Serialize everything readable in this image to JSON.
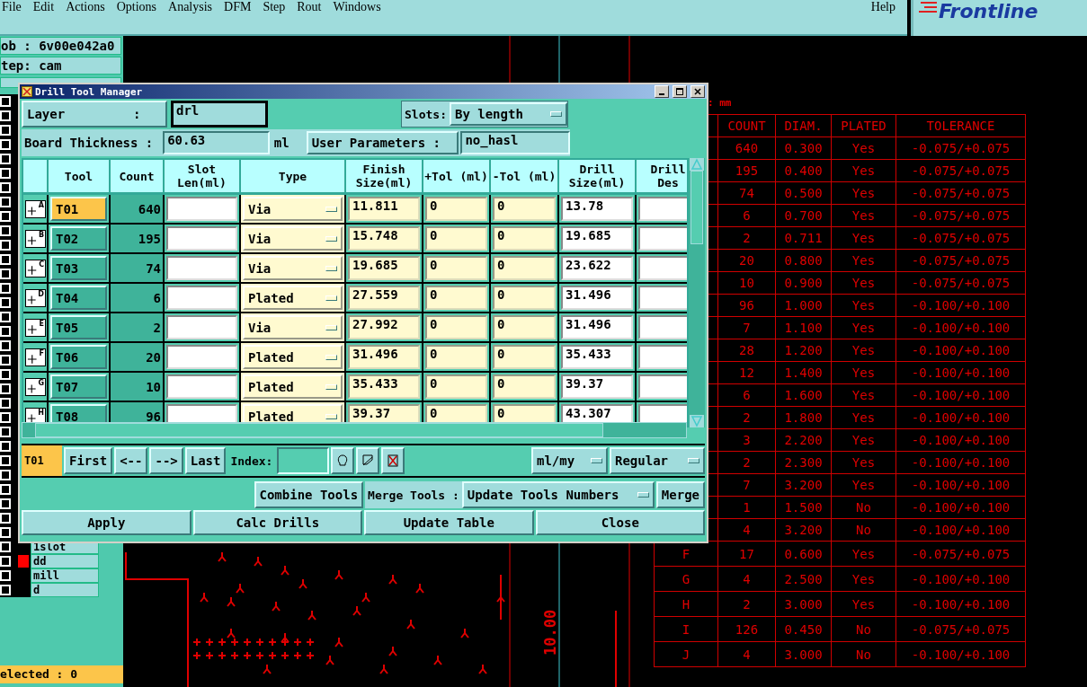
{
  "menu_bar": {
    "items": [
      "File",
      "Edit",
      "Actions",
      "Options",
      "Analysis",
      "DFM",
      "Step",
      "Rout",
      "Windows"
    ],
    "help": "Help",
    "logo": "Frontline"
  },
  "left_panel": {
    "job": "ob : 6v00e042a0",
    "step": "tep: cam",
    "layers": [
      {
        "name": "1slot",
        "selected": false
      },
      {
        "name": "dd",
        "selected": true
      },
      {
        "name": "mill",
        "selected": false
      },
      {
        "name": "d",
        "selected": false
      }
    ],
    "status": "elected : 0"
  },
  "canvas": {
    "units": ": mm",
    "columns": [
      "COUNT",
      "DIAM.",
      "PLATED",
      "TOLERANCE"
    ],
    "rows": [
      {
        "count": "640",
        "diam": "0.300",
        "plated": "Yes",
        "tolerance": "-0.075/+0.075"
      },
      {
        "count": "195",
        "diam": "0.400",
        "plated": "Yes",
        "tolerance": "-0.075/+0.075"
      },
      {
        "count": "74",
        "diam": "0.500",
        "plated": "Yes",
        "tolerance": "-0.075/+0.075"
      },
      {
        "count": "6",
        "diam": "0.700",
        "plated": "Yes",
        "tolerance": "-0.075/+0.075"
      },
      {
        "count": "2",
        "diam": "0.711",
        "plated": "Yes",
        "tolerance": "-0.075/+0.075"
      },
      {
        "count": "20",
        "diam": "0.800",
        "plated": "Yes",
        "tolerance": "-0.075/+0.075"
      },
      {
        "count": "10",
        "diam": "0.900",
        "plated": "Yes",
        "tolerance": "-0.075/+0.075"
      },
      {
        "count": "96",
        "diam": "1.000",
        "plated": "Yes",
        "tolerance": "-0.100/+0.100"
      },
      {
        "count": "7",
        "diam": "1.100",
        "plated": "Yes",
        "tolerance": "-0.100/+0.100"
      },
      {
        "count": "28",
        "diam": "1.200",
        "plated": "Yes",
        "tolerance": "-0.100/+0.100"
      },
      {
        "count": "12",
        "diam": "1.400",
        "plated": "Yes",
        "tolerance": "-0.100/+0.100"
      },
      {
        "count": "6",
        "diam": "1.600",
        "plated": "Yes",
        "tolerance": "-0.100/+0.100"
      },
      {
        "count": "2",
        "diam": "1.800",
        "plated": "Yes",
        "tolerance": "-0.100/+0.100"
      },
      {
        "count": "3",
        "diam": "2.200",
        "plated": "Yes",
        "tolerance": "-0.100/+0.100"
      },
      {
        "count": "2",
        "diam": "2.300",
        "plated": "Yes",
        "tolerance": "-0.100/+0.100"
      },
      {
        "count": "7",
        "diam": "3.200",
        "plated": "Yes",
        "tolerance": "-0.100/+0.100"
      },
      {
        "count": "1",
        "diam": "1.500",
        "plated": "No",
        "tolerance": "-0.100/+0.100"
      },
      {
        "count": "4",
        "diam": "3.200",
        "plated": "No",
        "tolerance": "-0.100/+0.100"
      },
      {
        "symbol": "F",
        "count": "17",
        "diam": "0.600",
        "plated": "Yes",
        "tolerance": "-0.075/+0.075"
      },
      {
        "symbol": "G",
        "count": "4",
        "diam": "2.500",
        "plated": "Yes",
        "tolerance": "-0.100/+0.100"
      },
      {
        "symbol": "H",
        "count": "2",
        "diam": "3.000",
        "plated": "Yes",
        "tolerance": "-0.100/+0.100"
      },
      {
        "symbol": "I",
        "count": "126",
        "diam": "0.450",
        "plated": "No",
        "tolerance": "-0.075/+0.075"
      },
      {
        "symbol": "J",
        "count": "4",
        "diam": "3.000",
        "plated": "No",
        "tolerance": "-0.100/+0.100"
      }
    ],
    "dimension_label": "10.00"
  },
  "dialog": {
    "title": "Drill Tool Manager",
    "layer_label": "Layer         :",
    "layer_value": "drl",
    "slots_label": "Slots:",
    "slots_value": "By length",
    "thickness_label": "Board Thickness :",
    "thickness_value": "60.63",
    "thickness_unit": "ml",
    "params_label": "User Parameters :",
    "params_value": "no_hasl",
    "columns": [
      "Tool",
      "Count",
      "Slot Len(ml)",
      "Type",
      "Finish Size(ml)",
      "+Tol (ml)",
      "-Tol (ml)",
      "Drill Size(ml)",
      "Drill Des"
    ],
    "rows": [
      {
        "symbol": "A",
        "tool": "T01",
        "selected": true,
        "count": "640",
        "type": "Via",
        "finish": "11.811",
        "plus_tol": "0",
        "minus_tol": "0",
        "drill": "13.78"
      },
      {
        "symbol": "B",
        "tool": "T02",
        "selected": false,
        "count": "195",
        "type": "Via",
        "finish": "15.748",
        "plus_tol": "0",
        "minus_tol": "0",
        "drill": "19.685"
      },
      {
        "symbol": "C",
        "tool": "T03",
        "selected": false,
        "count": "74",
        "type": "Via",
        "finish": "19.685",
        "plus_tol": "0",
        "minus_tol": "0",
        "drill": "23.622"
      },
      {
        "symbol": "D",
        "tool": "T04",
        "selected": false,
        "count": "6",
        "type": "Plated",
        "finish": "27.559",
        "plus_tol": "0",
        "minus_tol": "0",
        "drill": "31.496"
      },
      {
        "symbol": "E",
        "tool": "T05",
        "selected": false,
        "count": "2",
        "type": "Via",
        "finish": "27.992",
        "plus_tol": "0",
        "minus_tol": "0",
        "drill": "31.496"
      },
      {
        "symbol": "F",
        "tool": "T06",
        "selected": false,
        "count": "20",
        "type": "Plated",
        "finish": "31.496",
        "plus_tol": "0",
        "minus_tol": "0",
        "drill": "35.433"
      },
      {
        "symbol": "G",
        "tool": "T07",
        "selected": false,
        "count": "10",
        "type": "Plated",
        "finish": "35.433",
        "plus_tol": "0",
        "minus_tol": "0",
        "drill": "39.37"
      },
      {
        "symbol": "H",
        "tool": "T08",
        "selected": false,
        "count": "96",
        "type": "Plated",
        "finish": "39.37",
        "plus_tol": "0",
        "minus_tol": "0",
        "drill": "43.307"
      }
    ],
    "current_tool": "T01",
    "nav_buttons": [
      "First",
      "<--",
      "-->",
      "Last"
    ],
    "index_label": "Index:",
    "units_value": "ml/my",
    "mode_value": "Regular",
    "combine_button": "Combine Tools",
    "merge_label": "Merge Tools :",
    "merge_value": "Update Tools Numbers",
    "merge_button": "Merge",
    "actions": [
      "Apply",
      "Calc Drills",
      "Update Table",
      "Close"
    ]
  }
}
